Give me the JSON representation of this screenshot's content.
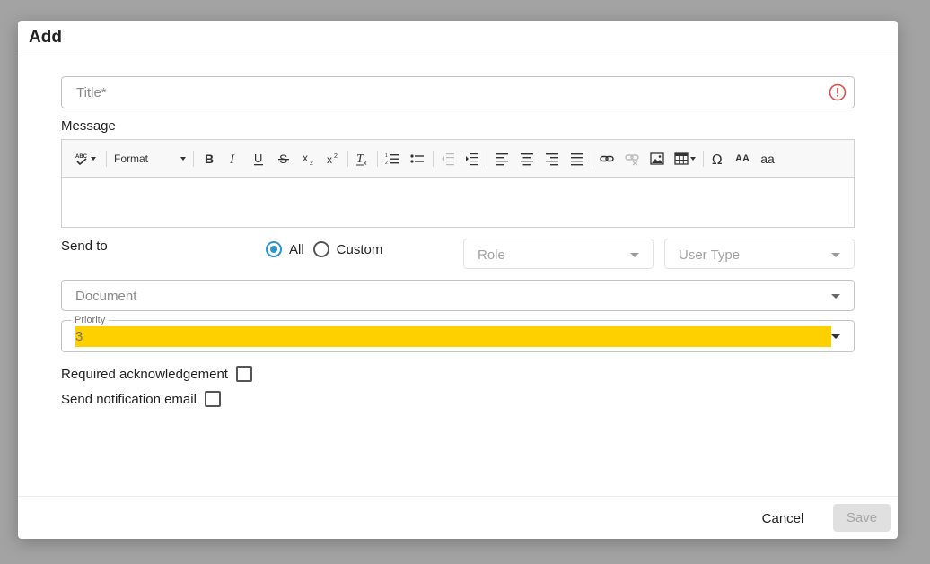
{
  "dialog": {
    "title": "Add"
  },
  "form": {
    "title_placeholder": "Title*",
    "message_label": "Message",
    "toolbar": {
      "format_label": "Format",
      "spellcheck_label": "ABC",
      "uppercase_label": "AA",
      "lowercase_label": "aa"
    },
    "send_to": {
      "label": "Send to",
      "options": [
        "All",
        "Custom"
      ],
      "selected": "All",
      "role_placeholder": "Role",
      "user_type_placeholder": "User Type"
    },
    "document_placeholder": "Document",
    "priority": {
      "label": "Priority",
      "value": "3"
    },
    "required_ack_label": "Required acknowledgement",
    "send_email_label": "Send notification email"
  },
  "footer": {
    "cancel_label": "Cancel",
    "save_label": "Save"
  },
  "colors": {
    "accent": "#2f95c7",
    "error": "#d9534f",
    "highlight": "#ffd000"
  }
}
